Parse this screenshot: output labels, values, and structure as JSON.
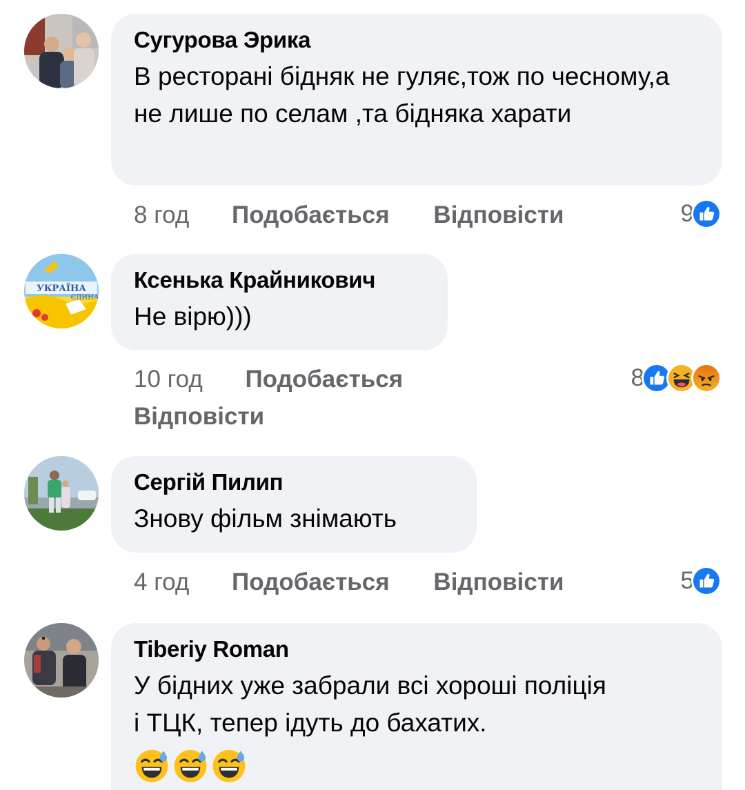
{
  "comments": [
    {
      "author": "Сугурова Эрика",
      "text": "В ресторані бідняк не гуляє,тож по чесному,а не лише по селам ,та бідняка харати",
      "time": "8 год",
      "like_label": "Подобається",
      "reply_label": "Відповісти",
      "reaction_count": "9",
      "reactions": [
        "like-icon"
      ]
    },
    {
      "author": "Ксенька Крайникович",
      "text": "Не вірю)))",
      "time": "10 год",
      "like_label": "Подобається",
      "reply_label": "Відповісти",
      "reaction_count": "8",
      "reactions": [
        "like-icon",
        "haha-icon",
        "angry-icon"
      ],
      "avatar_text": [
        "УКРАЇНА",
        "ЄДИНА"
      ]
    },
    {
      "author": "Сергій Пилип",
      "text": "Знову фільм знімають",
      "time": "4 год",
      "like_label": "Подобається",
      "reply_label": "Відповісти",
      "reaction_count": "5",
      "reactions": [
        "like-icon"
      ]
    },
    {
      "author": "Tiberiy Roman",
      "text": "У бідних уже забрали всі хороші поліція і ТЦК, тепер ідуть до бахатих.",
      "emojis": [
        "sweat-smile-emoji",
        "sweat-smile-emoji",
        "sweat-smile-emoji"
      ]
    }
  ],
  "colors": {
    "bubble": "#f0f2f5",
    "meta_text": "#65676b",
    "like_blue": "#1877f2",
    "angry_red": "#f05537",
    "haha_yellow": "#f7b125"
  }
}
